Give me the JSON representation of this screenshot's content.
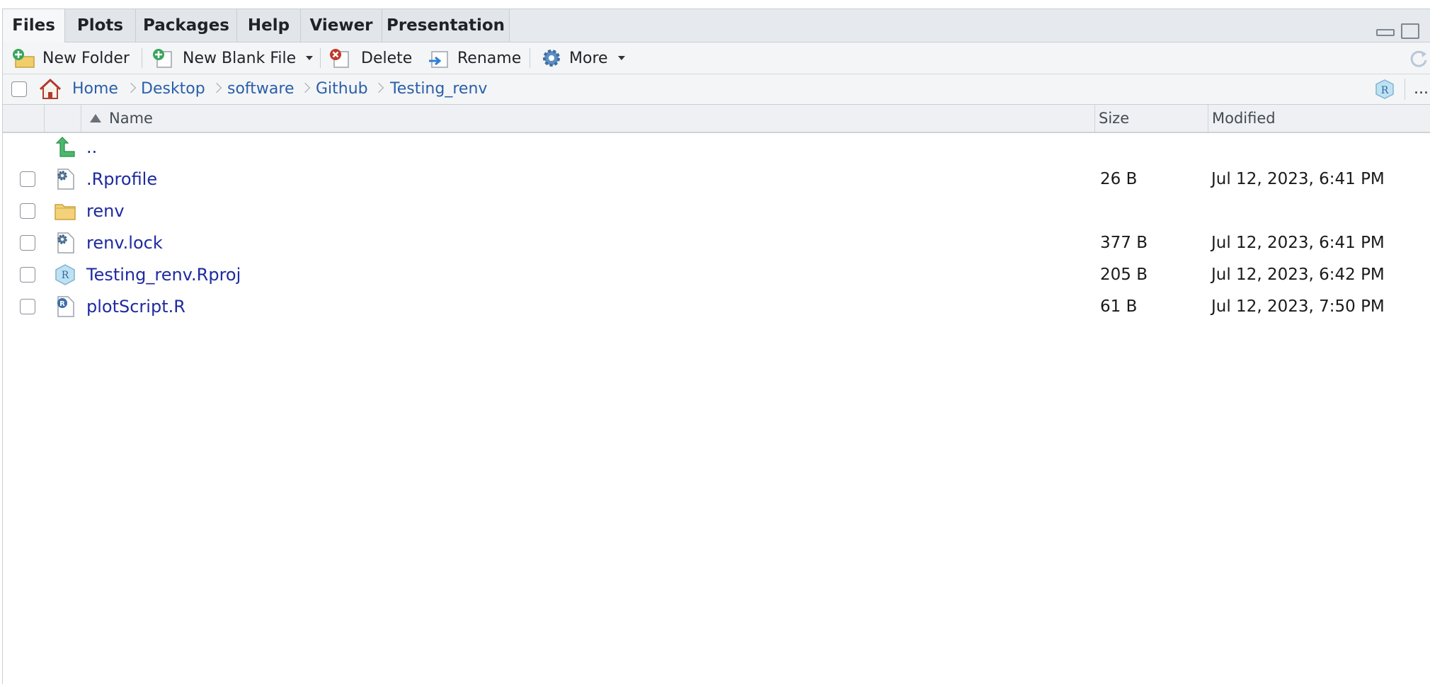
{
  "tabs": [
    {
      "label": "Files",
      "active": true
    },
    {
      "label": "Plots"
    },
    {
      "label": "Packages"
    },
    {
      "label": "Help"
    },
    {
      "label": "Viewer"
    },
    {
      "label": "Presentation"
    }
  ],
  "toolbar": {
    "new_folder": "New Folder",
    "new_blank_file": "New Blank File",
    "delete": "Delete",
    "rename": "Rename",
    "more": "More"
  },
  "breadcrumb": [
    "Home",
    "Desktop",
    "software",
    "Github",
    "Testing_renv"
  ],
  "path_more": "...",
  "columns": {
    "name": "Name",
    "size": "Size",
    "modified": "Modified"
  },
  "parent_dir": "..",
  "files": [
    {
      "name": ".Rprofile",
      "icon": "settings-file-icon",
      "size": "26 B",
      "modified": "Jul 12, 2023, 6:41 PM"
    },
    {
      "name": "renv",
      "icon": "folder-icon",
      "size": "",
      "modified": ""
    },
    {
      "name": "renv.lock",
      "icon": "settings-file-icon",
      "size": "377 B",
      "modified": "Jul 12, 2023, 6:41 PM"
    },
    {
      "name": "Testing_renv.Rproj",
      "icon": "rproj-file-icon",
      "size": "205 B",
      "modified": "Jul 12, 2023, 6:42 PM"
    },
    {
      "name": "plotScript.R",
      "icon": "r-script-icon",
      "size": "61 B",
      "modified": "Jul 12, 2023, 7:50 PM"
    }
  ],
  "colors": {
    "link": "#1f2aa0",
    "breadcrumb": "#2a5fa8",
    "tabbar": "#e6e9ed"
  }
}
